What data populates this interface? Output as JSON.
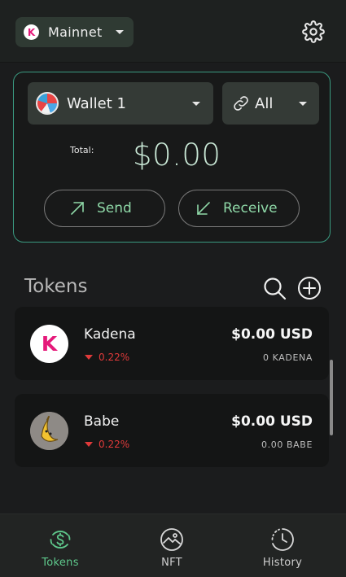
{
  "header": {
    "network_badge": "K",
    "network_label": "Mainnet"
  },
  "wallet": {
    "selector_label": "Wallet 1",
    "filter_label": "All",
    "total_label": "Total:",
    "total_value": "$0.00",
    "send_label": "Send",
    "receive_label": "Receive"
  },
  "tokens": {
    "title": "Tokens",
    "items": [
      {
        "icon_letter": "K",
        "name": "Kadena",
        "change": "0.22%",
        "usd": "$0.00 USD",
        "amount": "0 KADENA"
      },
      {
        "icon_letter": "",
        "name": "Babe",
        "change": "0.22%",
        "usd": "$0.00 USD",
        "amount": "0.00 BABE"
      }
    ]
  },
  "nav": {
    "tokens_label": "Tokens",
    "nft_label": "NFT",
    "history_label": "History"
  },
  "colors": {
    "accent": "#5fc98c",
    "negative": "#e03a3a",
    "kadena_brand": "#e5197a"
  }
}
